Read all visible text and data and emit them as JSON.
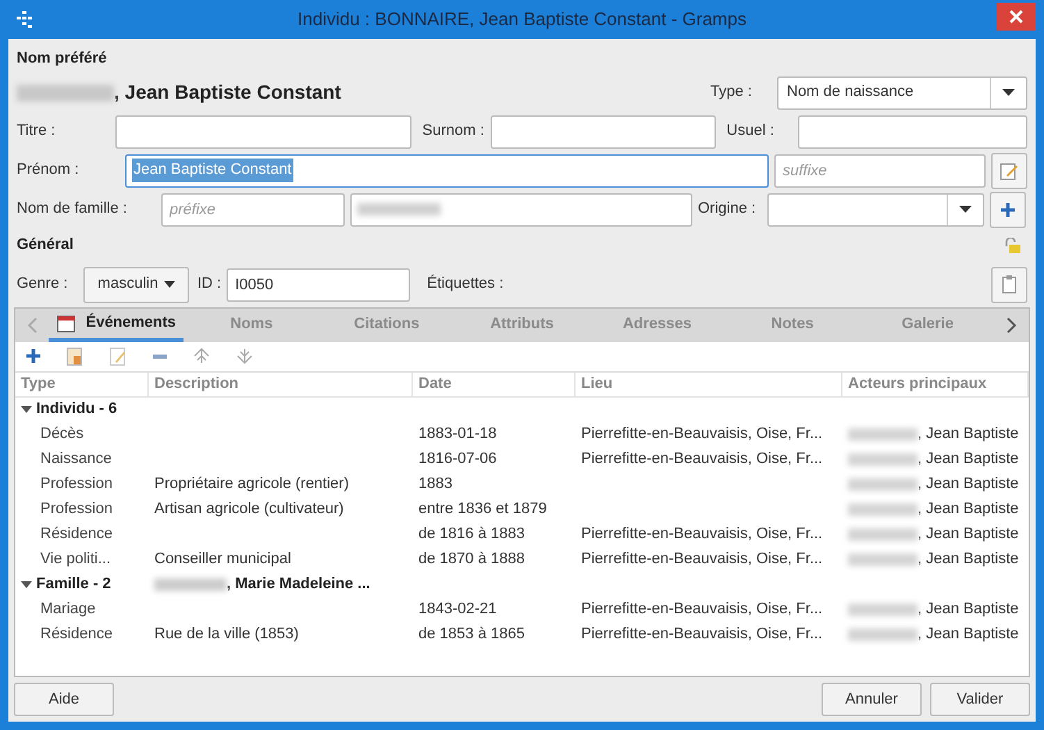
{
  "window": {
    "title": "Individu : BONNAIRE, Jean Baptiste Constant - Gramps"
  },
  "preferred_name": {
    "heading": "Nom préféré",
    "display_name": ", Jean Baptiste Constant",
    "type_label": "Type :",
    "type_value": "Nom de naissance"
  },
  "name_fields": [
    {
      "label": "Titre :"
    },
    {
      "label": "Surnom :"
    },
    {
      "label": "Usuel :"
    }
  ],
  "given": {
    "label": "Prénom :",
    "value": "Jean Baptiste Constant",
    "suffix_placeholder": "suffixe"
  },
  "surname": {
    "label": "Nom de famille :",
    "prefix_placeholder": "préfixe",
    "origin_label": "Origine :"
  },
  "general": {
    "heading": "Général",
    "gender_label": "Genre :",
    "gender_value": "masculin",
    "id_label": "ID :",
    "id_value": "I0050",
    "tags_label": "Étiquettes :"
  },
  "tabs": [
    {
      "label": "Événements",
      "selected": true
    },
    {
      "label": "Noms",
      "selected": false
    },
    {
      "label": "Citations",
      "selected": false
    },
    {
      "label": "Attributs",
      "selected": false
    },
    {
      "label": "Adresses",
      "selected": false
    },
    {
      "label": "Notes",
      "selected": false
    },
    {
      "label": "Galerie",
      "selected": false
    }
  ],
  "table": {
    "columns": [
      "Type",
      "Description",
      "Date",
      "Lieu",
      "Acteurs principaux"
    ],
    "groups": [
      {
        "label": "Individu - 6",
        "expanded": true,
        "rows": [
          {
            "type": "Décès",
            "date": "1883-01-18",
            "place": "Pierrefitte-en-Beauvaisis, Oise, Fr...",
            "actor": ", Jean Baptiste"
          },
          {
            "type": "Naissance",
            "date": "1816-07-06",
            "place": "Pierrefitte-en-Beauvaisis, Oise, Fr...",
            "actor": ", Jean Baptiste"
          },
          {
            "type": "Profession",
            "description": "Propriétaire agricole (rentier)",
            "date": "1883",
            "actor": ", Jean Baptiste"
          },
          {
            "type": "Profession",
            "description": "Artisan agricole (cultivateur)",
            "date": "entre 1836 et 1879",
            "actor": ", Jean Baptiste"
          },
          {
            "type": "Résidence",
            "date": "de 1816 à 1883",
            "place": "Pierrefitte-en-Beauvaisis, Oise, Fr...",
            "actor": ", Jean Baptiste"
          },
          {
            "type": "Vie politi...",
            "description": "Conseiller municipal",
            "date": "de 1870 à 1888",
            "place": "Pierrefitte-en-Beauvaisis, Oise, Fr...",
            "actor": ", Jean Baptiste"
          }
        ]
      },
      {
        "label": "Famille  - 2",
        "partner": ", Marie Madeleine ...",
        "expanded": true,
        "rows": [
          {
            "type": "Mariage",
            "date": "1843-02-21",
            "place": "Pierrefitte-en-Beauvaisis, Oise, Fr...",
            "actor": ", Jean Baptiste"
          },
          {
            "type": "Résidence",
            "description": "Rue de la ville (1853)",
            "date": "de 1853 à 1865",
            "place": "Pierrefitte-en-Beauvaisis, Oise, Fr...",
            "actor": ", Jean Baptiste"
          }
        ]
      }
    ]
  },
  "buttons": {
    "help": "Aide",
    "cancel": "Annuler",
    "ok": "Valider"
  }
}
